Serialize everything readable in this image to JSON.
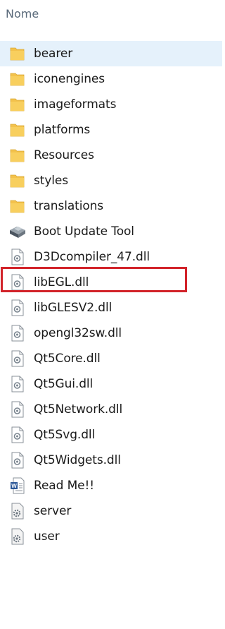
{
  "header": {
    "column_name": "Nome"
  },
  "items": [
    {
      "label": "bearer",
      "type": "folder",
      "selected": true
    },
    {
      "label": "iconengines",
      "type": "folder"
    },
    {
      "label": "imageformats",
      "type": "folder"
    },
    {
      "label": "platforms",
      "type": "folder"
    },
    {
      "label": "Resources",
      "type": "folder"
    },
    {
      "label": "styles",
      "type": "folder"
    },
    {
      "label": "translations",
      "type": "folder"
    },
    {
      "label": "Boot Update Tool",
      "type": "application",
      "highlighted": true
    },
    {
      "label": "D3Dcompiler_47.dll",
      "type": "dll"
    },
    {
      "label": "libEGL.dll",
      "type": "dll"
    },
    {
      "label": "libGLESV2.dll",
      "type": "dll"
    },
    {
      "label": "opengl32sw.dll",
      "type": "dll"
    },
    {
      "label": "Qt5Core.dll",
      "type": "dll"
    },
    {
      "label": "Qt5Gui.dll",
      "type": "dll"
    },
    {
      "label": "Qt5Network.dll",
      "type": "dll"
    },
    {
      "label": "Qt5Svg.dll",
      "type": "dll"
    },
    {
      "label": "Qt5Widgets.dll",
      "type": "dll"
    },
    {
      "label": "Read Me!!",
      "type": "document"
    },
    {
      "label": "server",
      "type": "config"
    },
    {
      "label": "user",
      "type": "config"
    }
  ],
  "colors": {
    "folder": "#f3c24c",
    "selection": "#e5f1fb",
    "highlight": "#d2232a",
    "header_text": "#5b6b7b"
  },
  "icons": {
    "folder": "folder-icon",
    "application": "application-icon",
    "dll": "dll-file-icon",
    "document": "document-icon",
    "config": "config-file-icon"
  }
}
